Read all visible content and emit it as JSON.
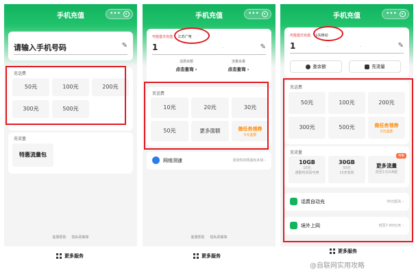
{
  "title": "手机充值",
  "capsule_dots": "•••",
  "more_services": "更多服务",
  "footer": {
    "help": "客服帮助",
    "privacy": "隐私政策等"
  },
  "phone1": {
    "placeholder": "请输入手机号码",
    "recharge_label": "充话费",
    "amounts": [
      "50元",
      "100元",
      "200元",
      "300元",
      "500元"
    ],
    "data_label": "充流量",
    "data_option": "特惠流量包"
  },
  "phone2": {
    "hint": "可能首次充值",
    "carrier": "江苏广电",
    "number": "1",
    "balance_label": "话费余额",
    "balance_action": "点击查询 ›",
    "flow_label": "流量余量",
    "flow_action": "点击查询 ›",
    "recharge_label": "充话费",
    "amounts": [
      "10元",
      "20元",
      "30元",
      "50元",
      "更多面额"
    ],
    "task": {
      "main": "做任务领券",
      "sub": "5元话费"
    },
    "speed_label": "网络测速",
    "speed_right": "测测你的网速有多快 ›"
  },
  "phone3": {
    "hint": "可能首次充值",
    "carrier": "山东移动",
    "number": "1",
    "btn_balance": "查余额",
    "btn_flow": "充流量",
    "recharge_label": "充话费",
    "amounts": [
      "50元",
      "100元",
      "200元",
      "300元",
      "500元"
    ],
    "task": {
      "main": "做任务领券",
      "sub": "5元话费"
    },
    "data_label": "充流量",
    "data_options": [
      {
        "main": "10GB",
        "sub1": "10元",
        "sub2": "通勤时间段可用"
      },
      {
        "main": "30GB",
        "sub1": "50元",
        "sub2": "15天有效"
      },
      {
        "main": "更多流量",
        "sub1": "低至1元/GB起",
        "sub2": ""
      }
    ],
    "hot_badge": "特惠",
    "auto_recharge": "话费自动充",
    "auto_right": "30元起充 ›",
    "abroad": "境外上网",
    "abroad_right": "低至7.99元/天 ›"
  },
  "watermark": "@自联网实用攻略",
  "colors": {
    "green": "#16b35f",
    "red_box": "#e0161e",
    "orange": "#ff8a00"
  }
}
